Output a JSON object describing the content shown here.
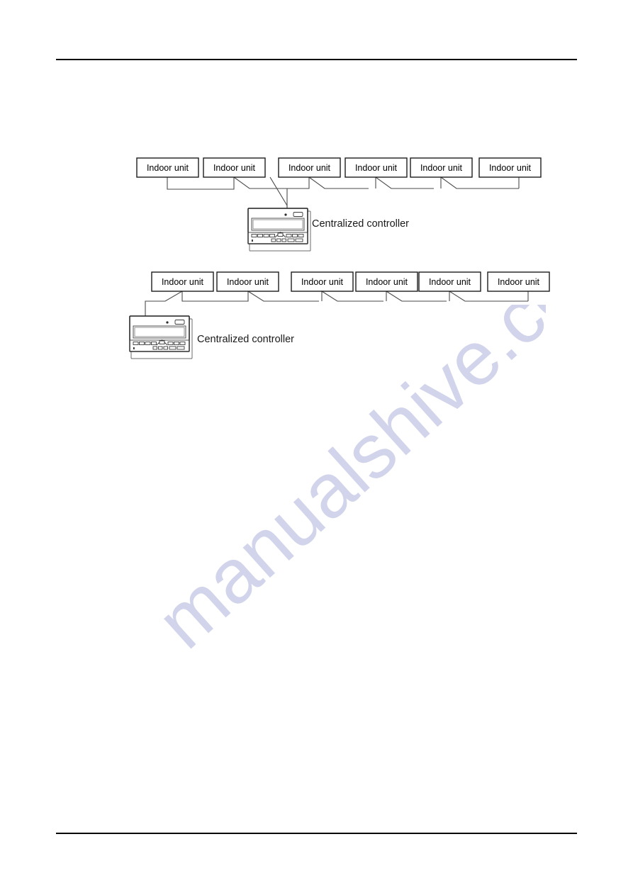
{
  "document": {
    "has_header_rule": true,
    "has_footer_rule": true,
    "background_color": "#ffffff",
    "line_color": "#000000"
  },
  "watermark": {
    "text": "manualshive.com",
    "color": "#c9cde8",
    "visible": true
  },
  "labels": {
    "indoor_unit": "Indoor unit",
    "centralized_controller": "Centralized controller"
  },
  "diagrams": [
    {
      "id": "diagram-1",
      "name": "centre-connected-centralized-controller",
      "indoor_unit_count": 6,
      "controller_label": "Centralized controller",
      "controller_position": "center-below",
      "units": [
        {
          "label": "Indoor unit",
          "index": 1
        },
        {
          "label": "Indoor unit",
          "index": 2
        },
        {
          "label": "Indoor unit",
          "index": 3
        },
        {
          "label": "Indoor unit",
          "index": 4
        },
        {
          "label": "Indoor unit",
          "index": 5
        },
        {
          "label": "Indoor unit",
          "index": 6
        }
      ]
    },
    {
      "id": "diagram-2",
      "name": "end-connected-centralized-controller",
      "indoor_unit_count": 6,
      "controller_label": "Centralized controller",
      "controller_position": "left-below",
      "units": [
        {
          "label": "Indoor unit",
          "index": 1
        },
        {
          "label": "Indoor unit",
          "index": 2
        },
        {
          "label": "Indoor unit",
          "index": 3
        },
        {
          "label": "Indoor unit",
          "index": 4
        },
        {
          "label": "Indoor unit",
          "index": 5
        },
        {
          "label": "Indoor unit",
          "index": 6
        }
      ]
    }
  ]
}
